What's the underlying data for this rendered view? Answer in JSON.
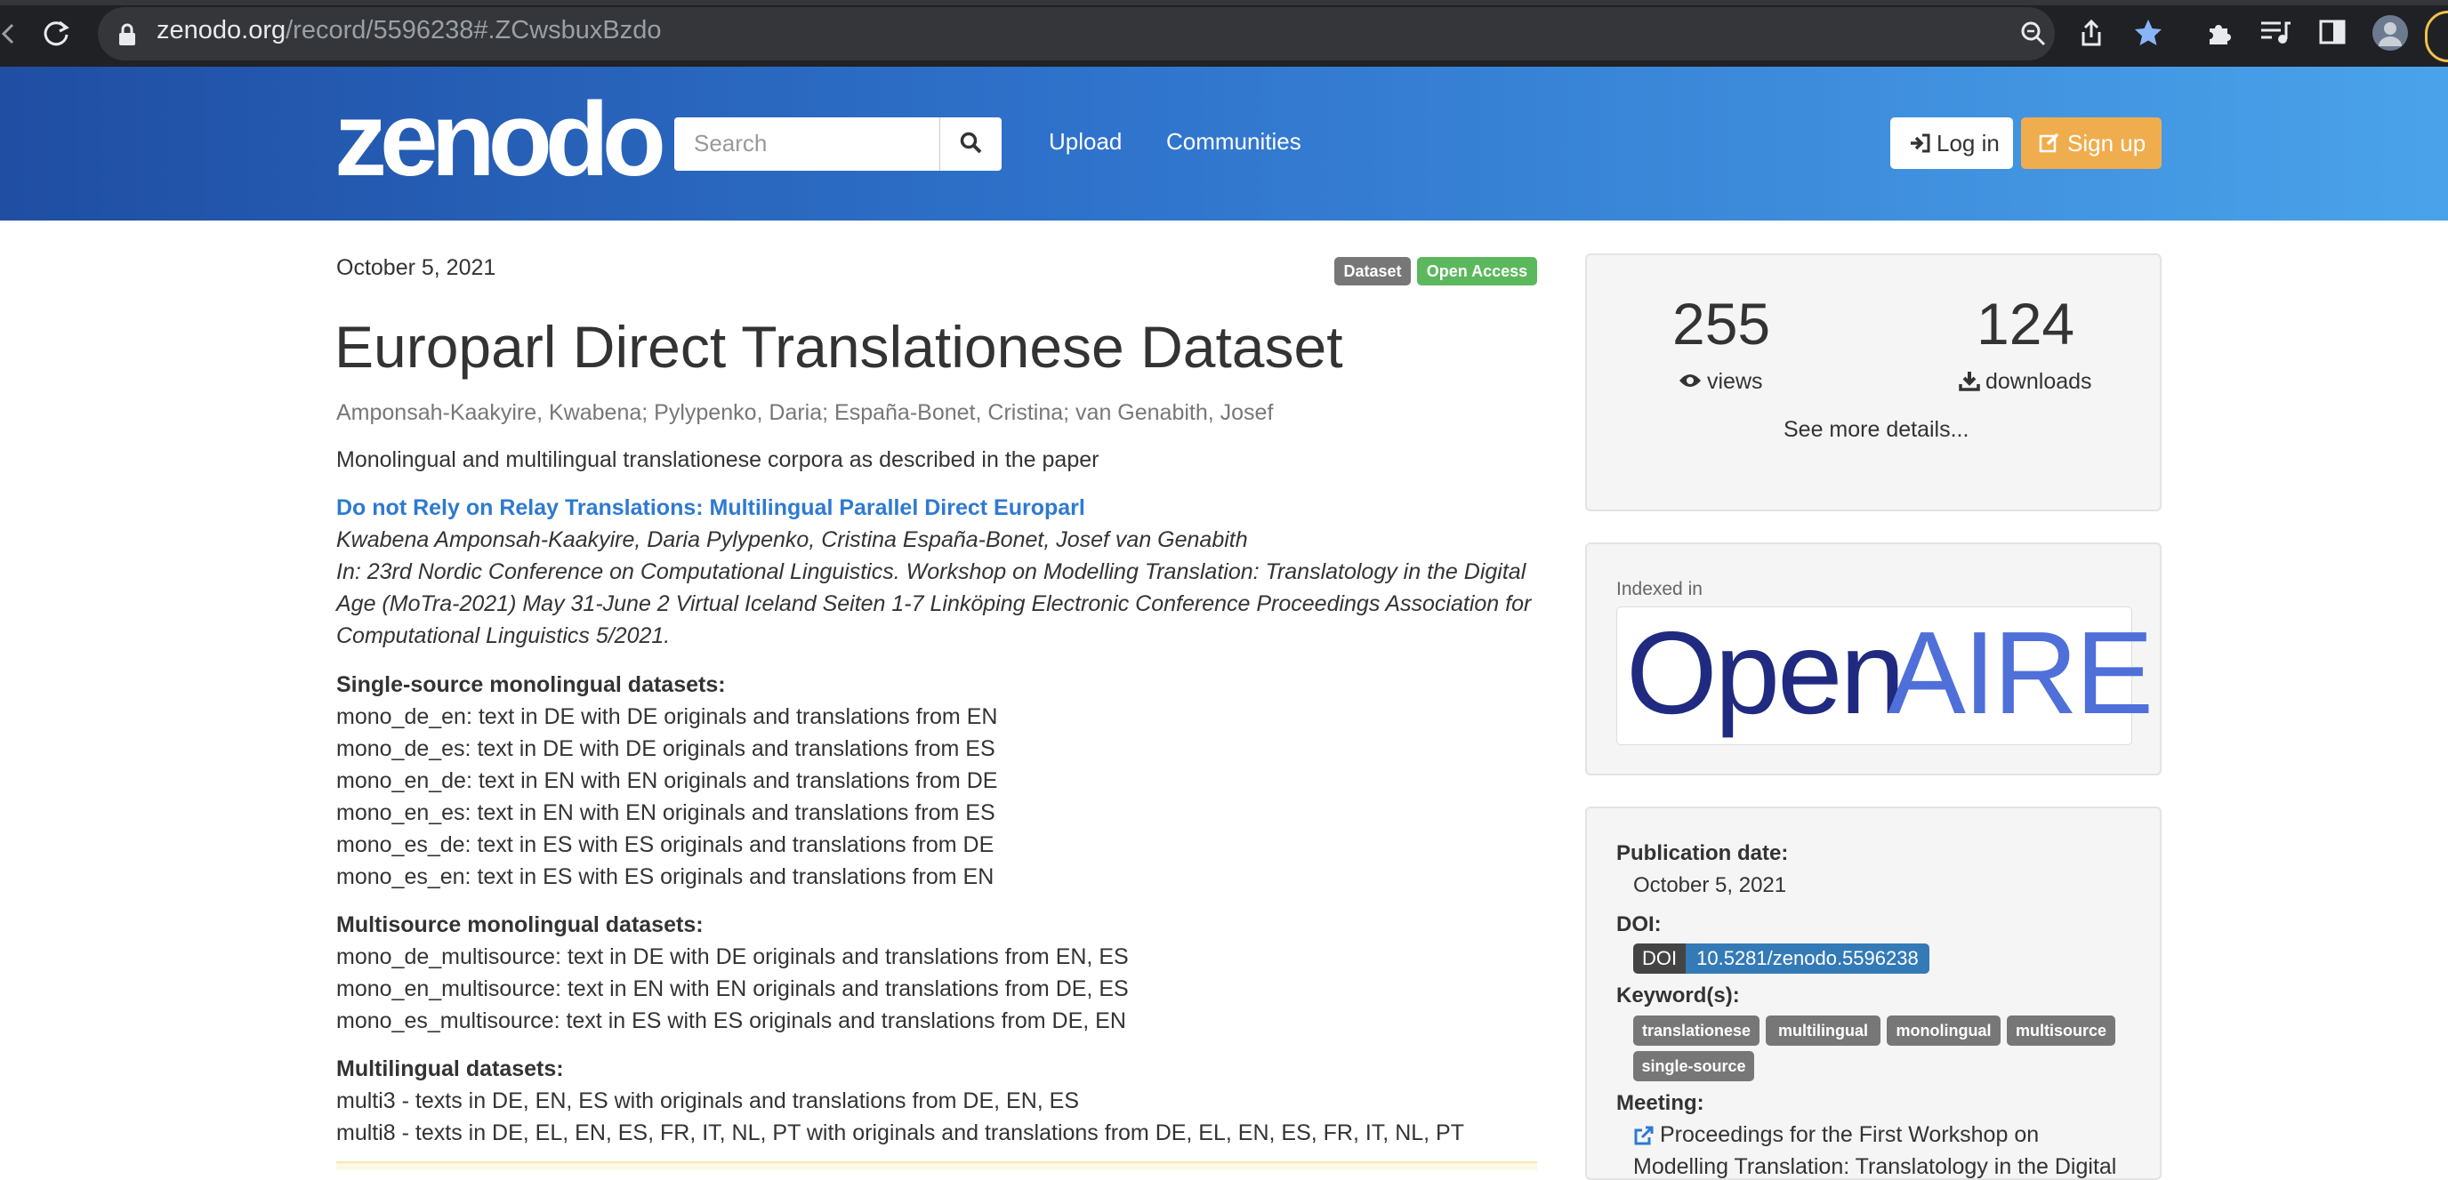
{
  "browser": {
    "url_domain": "zenodo.org",
    "url_path": "/record/5596238#.ZCwsbuxBzdo"
  },
  "header": {
    "logo": "zenodo",
    "search_placeholder": "Search",
    "nav": [
      "Upload",
      "Communities"
    ],
    "login": "Log in",
    "signup": "Sign up"
  },
  "record": {
    "date": "October 5, 2021",
    "badges": [
      "Dataset",
      "Open Access"
    ],
    "title": "Europarl Direct Translationese Dataset",
    "authors": [
      "Amponsah-Kaakyire, Kwabena",
      "Pylypenko, Daria",
      "España-Bonet, Cristina",
      "van Genabith, Josef"
    ],
    "description": "Monolingual and multilingual translationese corpora as described in the paper",
    "paper_title": "Do not Rely on Relay Translations: Multilingual Parallel Direct Europarl",
    "paper_authors": "Kwabena Amponsah-Kaakyire, Daria Pylypenko, Cristina España-Bonet, Josef van Genabith",
    "paper_venue": [
      "In: 23rd Nordic Conference on Computational Linguistics. Workshop on Modelling Translation: Translatology in the Digital",
      "Age (MoTra-2021) May 31-June 2 Virtual Iceland Seiten 1-7 Linköping Electronic Conference Proceedings Association for",
      "Computational Linguistics 5/2021."
    ],
    "sections": [
      {
        "heading": "Single-source monolingual datasets:",
        "lines": [
          "mono_de_en: text in DE with DE originals and translations from EN",
          "mono_de_es: text in DE with DE originals and translations from ES",
          "mono_en_de: text in EN with EN originals and translations from DE",
          "mono_en_es: text in EN with EN originals and translations from ES",
          "mono_es_de: text in ES with ES originals and translations from DE",
          "mono_es_en: text in ES with ES originals and translations from EN"
        ]
      },
      {
        "heading": "Multisource monolingual datasets:",
        "lines": [
          "mono_de_multisource: text in DE with DE originals and translations from EN, ES",
          "mono_en_multisource: text in EN with EN originals and translations from DE, ES",
          "mono_es_multisource: text in ES with ES originals and translations from DE, EN"
        ]
      },
      {
        "heading": "Multilingual datasets:",
        "lines": [
          "multi3 - texts in DE, EN, ES with originals and translations from DE, EN, ES",
          "multi8 - texts in DE, EL, EN, ES, FR, IT, NL, PT with originals and translations from DE, EL, EN, ES, FR, IT, NL, PT"
        ]
      }
    ]
  },
  "sidebar": {
    "views": "255",
    "views_label": "views",
    "downloads": "124",
    "downloads_label": "downloads",
    "see_more": "See more details...",
    "indexed_in": "Indexed in",
    "openaire_open": "Open",
    "openaire_aire": "AIRE",
    "pub_date_label": "Publication date:",
    "pub_date": "October 5, 2021",
    "doi_label": "DOI:",
    "doi_key": "DOI",
    "doi_value": "10.5281/zenodo.5596238",
    "keywords_label": "Keyword(s):",
    "keywords": [
      "translationese",
      "multilingual",
      "monolingual",
      "multisource",
      "single-source"
    ],
    "meeting_label": "Meeting:",
    "meeting_link": [
      "Proceedings for the First Workshop on",
      "Modelling Translation: Translatology in the Digital"
    ]
  },
  "colors": {
    "header_start": "#1f4ea3",
    "header_end": "#4aa3ea",
    "link": "#2e7ad1",
    "signup": "#f0ad4e",
    "badge_dataset": "#777777",
    "badge_open_access": "#5cb85c",
    "doi_blue": "#337ab7"
  }
}
